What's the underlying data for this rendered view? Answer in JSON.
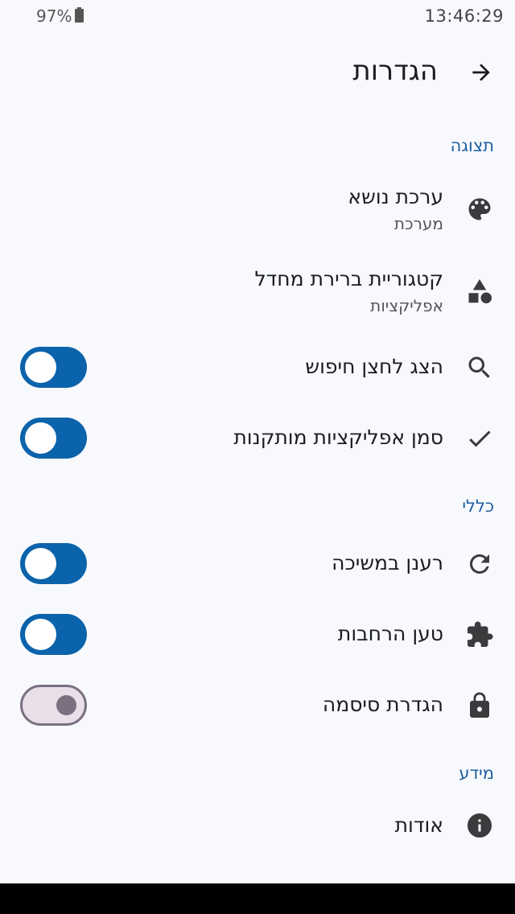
{
  "status_bar": {
    "time": "13:46:29",
    "battery": "97%"
  },
  "app_bar": {
    "title": "הגדרות"
  },
  "sections": {
    "display": "תצוגה",
    "general": "כללי",
    "info": "מידע"
  },
  "rows": {
    "theme": {
      "title": "ערכת נושא",
      "subtitle": "מערכת"
    },
    "picker_category": {
      "title": "קטגוריית ברירת מחדל",
      "subtitle": "אפליקציות"
    },
    "show_search": {
      "title": "הצג לחצן חיפוש",
      "toggle": "on"
    },
    "mark_installed": {
      "title": "סמן אפליקציות מותקנות",
      "toggle": "on"
    },
    "pull_refresh": {
      "title": "רענן במשיכה",
      "toggle": "on"
    },
    "load_extensions": {
      "title": "טען הרחבות",
      "toggle": "on"
    },
    "set_password": {
      "title": "הגדרת סיסמה",
      "toggle": "off-disabled"
    },
    "about": {
      "title": "אודות"
    }
  },
  "colors": {
    "accent": "#0b63ab",
    "section_header": "#1d5ea0",
    "background": "#f7f9fd"
  },
  "icons": [
    "arrow-forward-icon",
    "palette-icon",
    "shapes-icon",
    "search-icon",
    "check-icon",
    "refresh-icon",
    "extension-icon",
    "lock-icon",
    "info-icon",
    "battery-icon"
  ]
}
